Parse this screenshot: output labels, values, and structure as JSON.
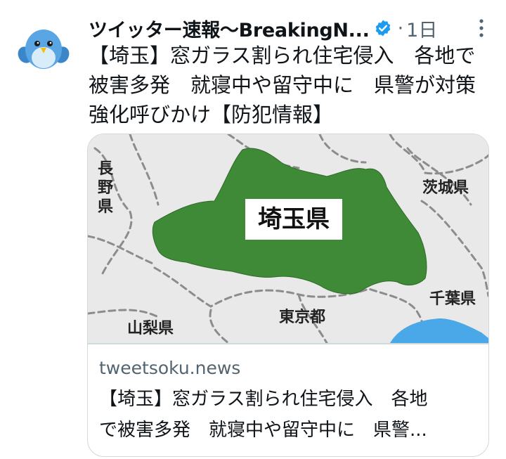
{
  "tweet": {
    "display_name": "ツイッター速報〜BreakingN...",
    "separator": "·",
    "time": "1日",
    "text": "【埼玉】窓ガラス割られ住宅侵入　各地で\n被害多発　就寝中や留守中に　県警が対策\n強化呼びかけ【防犯情報】"
  },
  "card": {
    "domain": "tweetsoku.news",
    "title": "【埼玉】窓ガラス割られ住宅侵入　各地\nで被害多発　就寝中や留守中に　県警...",
    "map": {
      "saitama_label": "埼玉県",
      "nagano_label": "長野県",
      "ibaraki_label": "茨城県",
      "chiba_label": "千葉県",
      "tokyo_label": "東京都",
      "yamanashi_label": "山梨県"
    }
  },
  "colors": {
    "verified": "#1d9bf0",
    "saitama_fill": "#3f8a37",
    "map_bg": "#e9e9e9",
    "water": "#4aa8e8",
    "muted_text": "#536471"
  },
  "icons": {
    "avatar": "bird-avatar",
    "verified": "verified-badge-icon",
    "more": "more-options-icon"
  }
}
